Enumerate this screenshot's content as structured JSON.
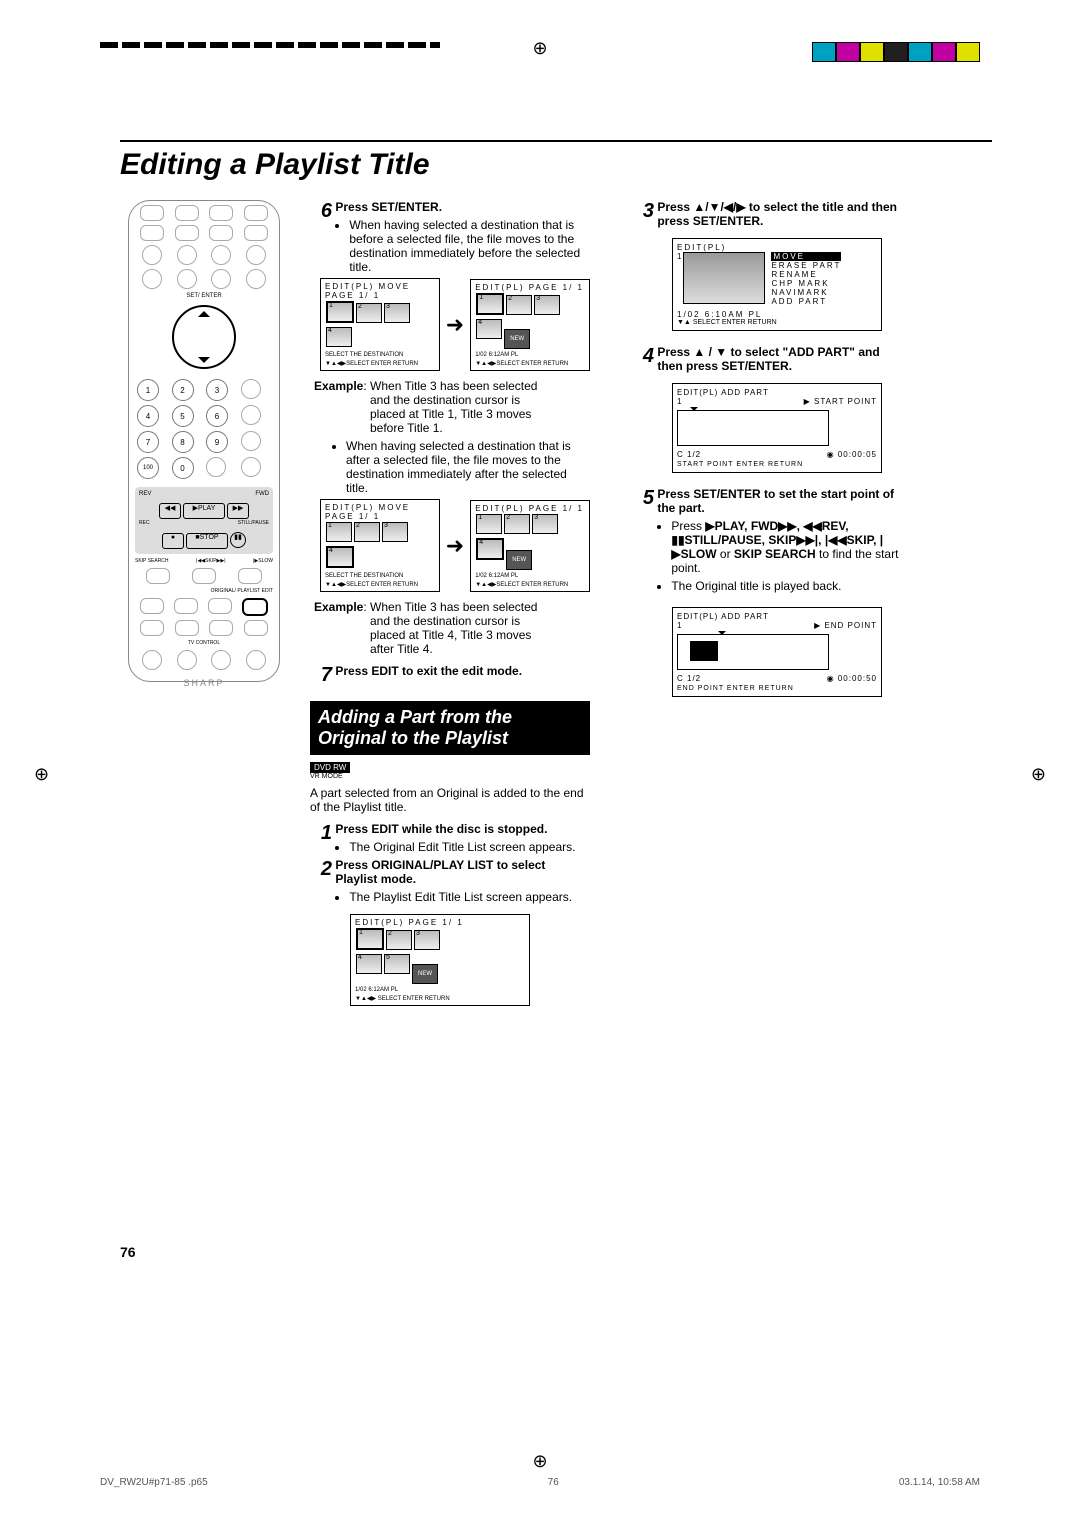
{
  "page_title": "Editing a Playlist Title",
  "page_number": "76",
  "footer": {
    "file": "DV_RW2U#p71-85 .p65",
    "center": "76",
    "right": "03.1.14, 10:58 AM"
  },
  "crop_colors": [
    "#00a0c0",
    "#c000a0",
    "#e0e000",
    "#202020",
    "#00a0c0",
    "#c000a0",
    "#e0e000"
  ],
  "remote": {
    "brand": "SHARP",
    "labels": {
      "set_enter": "SET/\nENTER",
      "play": "▶PLAY",
      "stop": "■STOP",
      "rev": "REV",
      "fwd": "FWD",
      "rec": "REC",
      "still": "STILL/PAUSE",
      "skip_search": "SKIP\nSEARCH",
      "skip": "|◀◀SKIP▶▶|",
      "slow": "|▶SLOW",
      "edit": "EDIT",
      "playlist": "ORIGINAL/\nPLAYLIST",
      "tv": "TV CONTROL"
    }
  },
  "mid": {
    "step6": {
      "num": "6",
      "head": "Press ",
      "head_bold": "SET/ENTER",
      "head_end": ".",
      "b1": "When having selected a destination that is before a selected file, the file moves to the destination immediately before the selected title."
    },
    "osc_a": {
      "title": "EDIT(PL)  MOVE  PAGE 1/ 1",
      "foot1": "SELECT THE DESTINATION",
      "foot2": "SELECT  ENTER  RETURN"
    },
    "osc_b": {
      "title": "EDIT(PL)       PAGE 1/ 1",
      "new": "NEW",
      "date": "1/02  6:12AM  PL",
      "foot2": "SELECT  ENTER  RETURN"
    },
    "example1": {
      "label": "Example",
      "head": ": When Title 3 has been selected",
      "l2": "and the destination cursor is",
      "l3": "placed at Title 1, Title 3 moves",
      "l4": "before Title 1."
    },
    "b2": "When having selected a destination that is after a selected file, the file moves to the destination immediately after the selected title.",
    "osc_c": {
      "title": "EDIT(PL)  MOVE  PAGE 1/ 1",
      "foot1": "SELECT THE DESTINATION",
      "foot2": "SELECT  ENTER  RETURN"
    },
    "osc_d": {
      "title": "EDIT(PL)       PAGE 1/ 1",
      "new": "NEW",
      "date": "1/02  6:12AM  PL",
      "foot2": "SELECT  ENTER  RETURN"
    },
    "example2": {
      "label": "Example",
      "head": ": When Title 3 has been selected",
      "l2": "and the destination cursor is",
      "l3": "placed at Title 4, Title 3 moves",
      "l4": "after Title 4."
    },
    "step7": {
      "num": "7",
      "txt_a": "Press ",
      "txt_b": "EDIT",
      "txt_c": " to exit the edit mode."
    },
    "section": "Adding a Part from the Original to the Playlist",
    "badge": "DVD RW",
    "sub_badge": "VR MODE",
    "intro": "A part selected from an Original is added to the end of the Playlist title.",
    "step1": {
      "num": "1",
      "a": "Press ",
      "b": "EDIT",
      "c": " while the disc is stopped.",
      "bul": "The Original Edit Title List screen appears."
    },
    "step2": {
      "num": "2",
      "a": "Press ",
      "b": "ORIGINAL/PLAY LIST",
      "c": " to select Playlist mode.",
      "bul": "The Playlist Edit Title List screen appears."
    },
    "osc_list": {
      "title": "EDIT(PL)       PAGE 1/ 1",
      "new": "NEW",
      "date": "1/02  6:12AM  PL",
      "foot": "SELECT  ENTER  RETURN"
    }
  },
  "right": {
    "step3": {
      "num": "3",
      "a": "Press ",
      "b": "▲/▼/◀/▶",
      "c": " to select the title and then press ",
      "d": "SET/ENTER",
      "e": "."
    },
    "osc_edit": {
      "title": "EDIT(PL)",
      "n": "1",
      "menu": [
        "MOVE",
        "ERASE PART",
        "RENAME",
        "CHP MARK",
        "NAVIMARK",
        "ADD PART"
      ],
      "selected": "MOVE",
      "date": "1/02  6:10AM  PL",
      "foot": "SELECT  ENTER  RETURN"
    },
    "step4": {
      "num": "4",
      "a": "Press ",
      "b": "▲ / ▼",
      "c": " to select \"ADD PART\" and then press ",
      "d": "SET/ENTER",
      "e": "."
    },
    "osc_start": {
      "title": "EDIT(PL)  ADD PART",
      "row": "▶  START POINT",
      "c": "C  1/2",
      "t": "00:00:05",
      "foot": "START POINT  ENTER  RETURN"
    },
    "step5": {
      "num": "5",
      "a": "Press ",
      "b": "SET/ENTER",
      "c": " to set the start point of the part.",
      "bul1a": "Press ",
      "bul1_items": "▶PLAY, FWD▶▶, ◀◀REV, ▮▮STILL/PAUSE, SKIP▶▶|, |◀◀SKIP, |▶SLOW",
      "bul1_or": " or ",
      "bul1_last": "SKIP SEARCH",
      "bul1_end": " to find the start point.",
      "bul2": "The Original title is played back."
    },
    "osc_end": {
      "title": "EDIT(PL)  ADD PART",
      "row": "▶  END POINT",
      "c": "C  1/2",
      "t": "00:00:50",
      "foot": "END POINT  ENTER  RETURN"
    }
  }
}
